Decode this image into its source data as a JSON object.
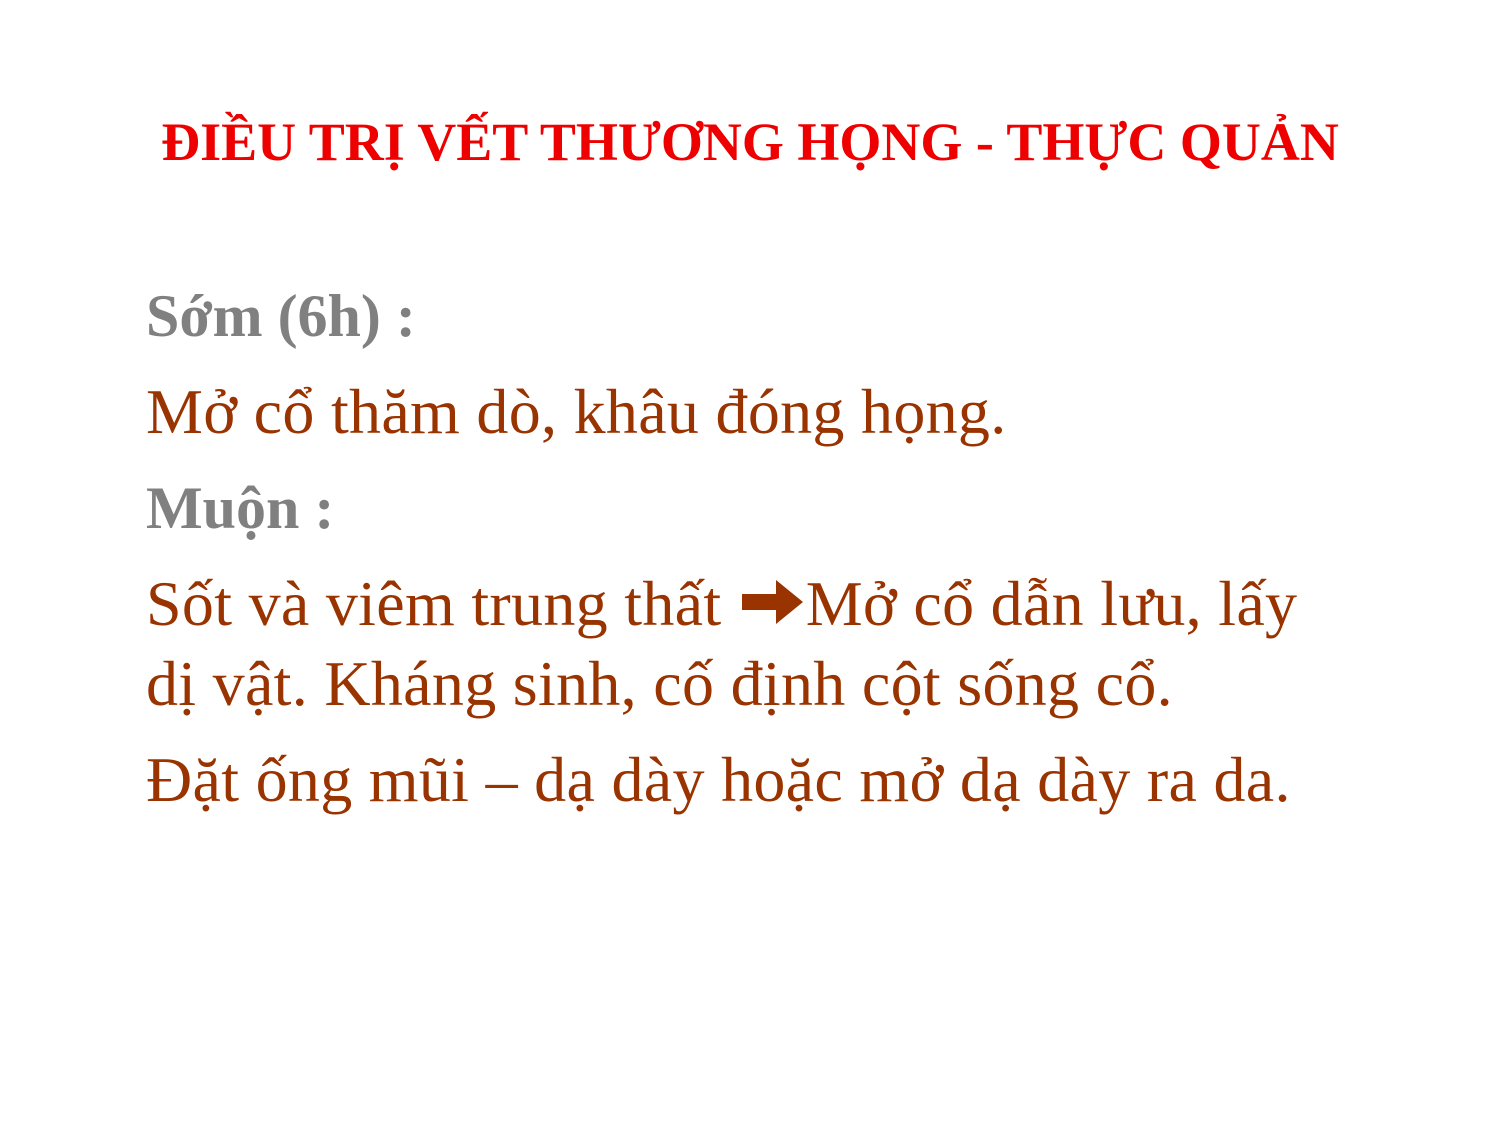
{
  "slide": {
    "title": "ĐIỀU TRỊ VẾT THƯƠNG HỌNG - THỰC QUẢN",
    "sections": {
      "early": {
        "heading": "Sớm (6h) :",
        "text": "Mở cổ thăm dò, khâu đóng họng."
      },
      "late": {
        "heading": "Muộn :",
        "line1_before_arrow": "Sốt và viêm trung thất ",
        "arrow_icon": "right-arrow-icon",
        "line1_after_arrow": "Mở cổ dẫn lưu, lấy",
        "line2": "dị vật. Kháng sinh, cố định cột sống cổ.",
        "line3": "Đặt ống mũi – dạ dày hoặc mở dạ dày ra da."
      }
    },
    "colors": {
      "title": "#ee0000",
      "heading": "#808080",
      "body": "#993300",
      "background": "#ffffff"
    }
  }
}
